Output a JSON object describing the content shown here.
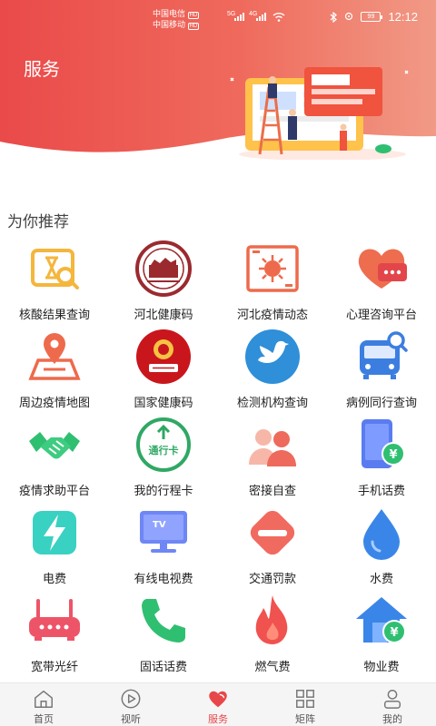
{
  "status_bar": {
    "carrier1": "中国电信",
    "carrier2": "中国移动",
    "network1": "5G",
    "network2": "4G",
    "hd_badge": "HD",
    "battery": "99",
    "time": "12:12"
  },
  "header": {
    "title": "服务"
  },
  "section": {
    "title": "为你推荐"
  },
  "services": [
    {
      "label": "核酸结果查询",
      "icon": "nucleic-test-icon"
    },
    {
      "label": "河北健康码",
      "icon": "hebei-emblem-icon"
    },
    {
      "label": "河北疫情动态",
      "icon": "virus-icon"
    },
    {
      "label": "心理咨询平台",
      "icon": "heart-chat-icon"
    },
    {
      "label": "周边疫情地图",
      "icon": "map-pin-icon"
    },
    {
      "label": "国家健康码",
      "icon": "national-emblem-icon"
    },
    {
      "label": "检测机构查询",
      "icon": "bird-icon"
    },
    {
      "label": "病例同行查询",
      "icon": "bus-search-icon"
    },
    {
      "label": "疫情求助平台",
      "icon": "handshake-icon"
    },
    {
      "label": "我的行程卡",
      "icon": "travel-card-icon"
    },
    {
      "label": "密接自查",
      "icon": "contacts-icon"
    },
    {
      "label": "手机话费",
      "icon": "phone-bill-icon"
    },
    {
      "label": "电费",
      "icon": "lightning-icon"
    },
    {
      "label": "有线电视费",
      "icon": "tv-icon"
    },
    {
      "label": "交通罚款",
      "icon": "traffic-fine-icon"
    },
    {
      "label": "水费",
      "icon": "water-drop-icon"
    },
    {
      "label": "宽带光纤",
      "icon": "router-icon"
    },
    {
      "label": "固话话费",
      "icon": "telephone-icon"
    },
    {
      "label": "燃气费",
      "icon": "flame-icon"
    },
    {
      "label": "物业费",
      "icon": "house-yuan-icon"
    }
  ],
  "tabs": [
    {
      "label": "首页",
      "icon": "home-icon",
      "active": false
    },
    {
      "label": "视听",
      "icon": "play-icon",
      "active": false
    },
    {
      "label": "服务",
      "icon": "heart-icon",
      "active": true
    },
    {
      "label": "矩阵",
      "icon": "grid-icon",
      "active": false
    },
    {
      "label": "我的",
      "icon": "user-icon",
      "active": false
    }
  ],
  "colors": {
    "accent": "#e8474a",
    "header_start": "#ea4a4a",
    "header_end": "#f19a86"
  }
}
